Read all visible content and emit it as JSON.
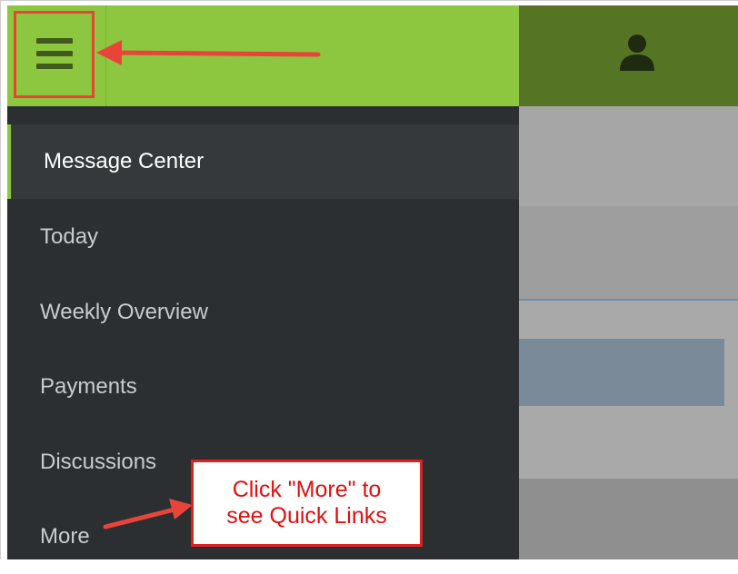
{
  "colors": {
    "header_green": "#8dc63f",
    "dark_green": "#557424",
    "drawer_bg": "#2b2f31",
    "annotation_red": "#e8443a"
  },
  "header": {
    "menu_icon": "hamburger-icon",
    "user_icon": "user-icon"
  },
  "nav": {
    "items": [
      {
        "label": "Message Center",
        "active": true
      },
      {
        "label": "Today"
      },
      {
        "label": "Weekly Overview"
      },
      {
        "label": "Payments"
      },
      {
        "label": "Discussions"
      },
      {
        "label": "More"
      }
    ]
  },
  "annotation": {
    "line1": "Click \"More\" to",
    "line2": "see Quick Links"
  }
}
